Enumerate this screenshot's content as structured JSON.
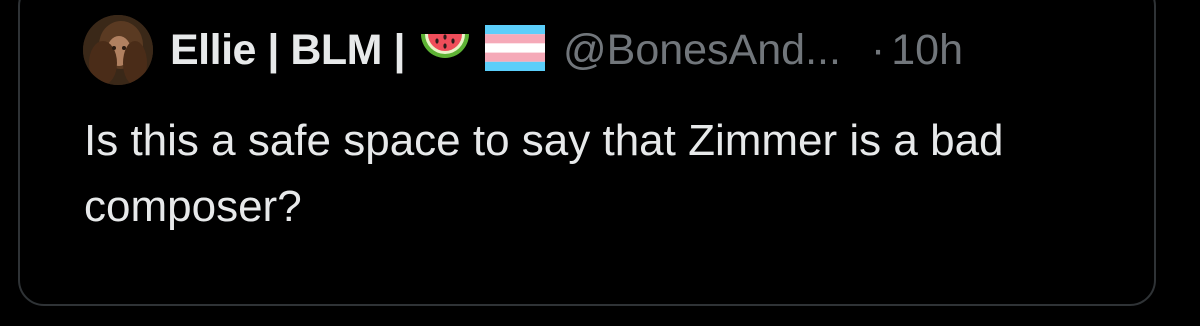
{
  "tweet": {
    "display_name": "Ellie | BLM |",
    "handle": "@BonesAnd...",
    "separator": "·",
    "time": "10h",
    "text": "Is this a safe space to say that Zimmer is a bad composer?",
    "emojis": [
      "watermelon-emoji",
      "transgender-flag-emoji"
    ]
  },
  "colors": {
    "background": "#000000",
    "border": "#2f3336",
    "primary_text": "#e7e9ea",
    "secondary_text": "#71767b"
  }
}
